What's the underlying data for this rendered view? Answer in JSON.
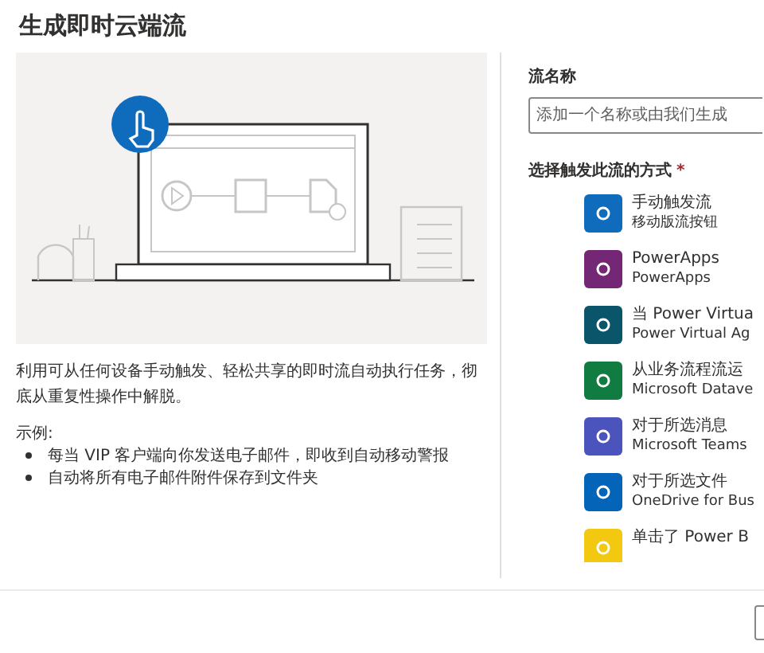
{
  "title": "生成即时云端流",
  "description": "利用可从任何设备手动触发、轻松共享的即时流自动执行任务，彻底从重复性操作中解脱。",
  "examples_label": "示例:",
  "examples": [
    "每当 VIP 客户端向你发送电子邮件，即收到自动移动警报",
    "自动将所有电子邮件附件保存到文件夹"
  ],
  "flow_name": {
    "label": "流名称",
    "placeholder": "添加一个名称或由我们生成"
  },
  "trigger_section": {
    "label": "选择触发此流的方式",
    "required_mark": "*"
  },
  "triggers": [
    {
      "title": "手动触发流",
      "subtitle": "移动版流按钮",
      "color": "#0f6cbd",
      "selected": false
    },
    {
      "title": "PowerApps",
      "subtitle": "PowerApps",
      "color": "#742774",
      "selected": false
    },
    {
      "title": "当 Power Virtua",
      "subtitle": "Power Virtual Ag",
      "color": "#0b556a",
      "selected": false
    },
    {
      "title": "从业务流程流运",
      "subtitle": "Microsoft Datave",
      "color": "#107c41",
      "selected": false
    },
    {
      "title": "对于所选消息",
      "subtitle": "Microsoft Teams",
      "color": "#4b53bc",
      "selected": false
    },
    {
      "title": "对于所选文件",
      "subtitle": "OneDrive for Bus",
      "color": "#0364b8",
      "selected": false
    },
    {
      "title": "单击了 Power B",
      "color": "#f2c811",
      "selected": false
    }
  ]
}
